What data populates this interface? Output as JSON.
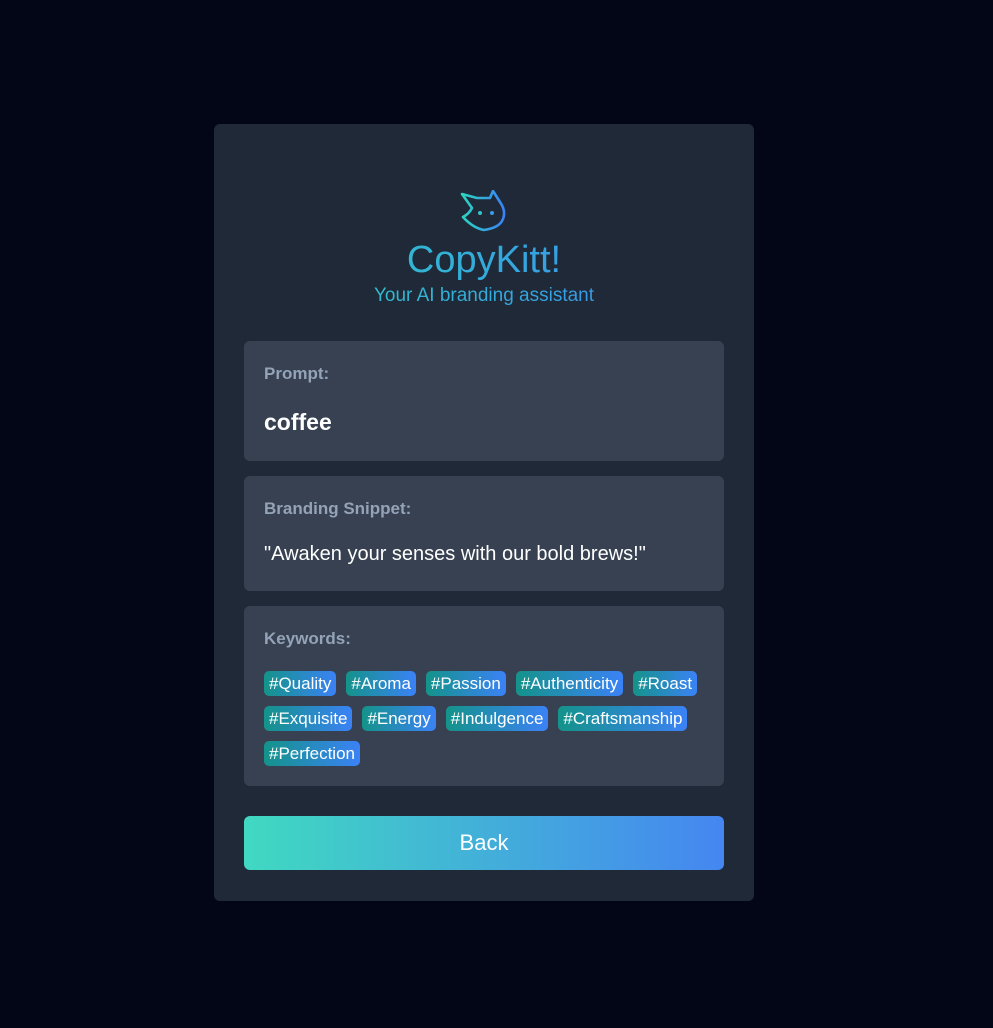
{
  "app": {
    "title": "CopyKitt!",
    "subtitle": "Your AI branding assistant",
    "logo_icon": "cat-head-icon"
  },
  "prompt": {
    "label": "Prompt:",
    "value": "coffee"
  },
  "snippet": {
    "label": "Branding Snippet:",
    "value": "\"Awaken your senses with our bold brews!\""
  },
  "keywords": {
    "label": "Keywords:",
    "items": [
      "#Quality",
      "#Aroma",
      "#Passion",
      "#Authenticity",
      "#Roast",
      "#Exquisite",
      "#Energy",
      "#Indulgence",
      "#Craftsmanship",
      "#Perfection"
    ]
  },
  "actions": {
    "back_label": "Back"
  },
  "colors": {
    "page_background": "#030616",
    "card_background": "#1f2937",
    "panel_background": "#374151",
    "accent_start": "#2dd4bf",
    "accent_end": "#3b82f6"
  }
}
